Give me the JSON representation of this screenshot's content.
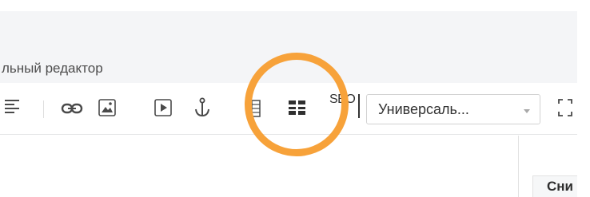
{
  "editor": {
    "title": "льный редактор"
  },
  "toolbar": {
    "icons": [
      "align-justify-icon",
      "link-icon",
      "image-icon",
      "video-icon",
      "anchor-icon",
      "table-icon",
      "template-grid-icon",
      "seo-icon",
      "fullscreen-icon"
    ],
    "seo_label": "SEO",
    "format_select": {
      "value": "Универсаль..."
    }
  },
  "side_panel": {
    "tab_label": "Сни"
  },
  "colors": {
    "highlight": "#f7a23a",
    "header_bg": "#f4f5f7",
    "icon": "#4a4a4a"
  }
}
